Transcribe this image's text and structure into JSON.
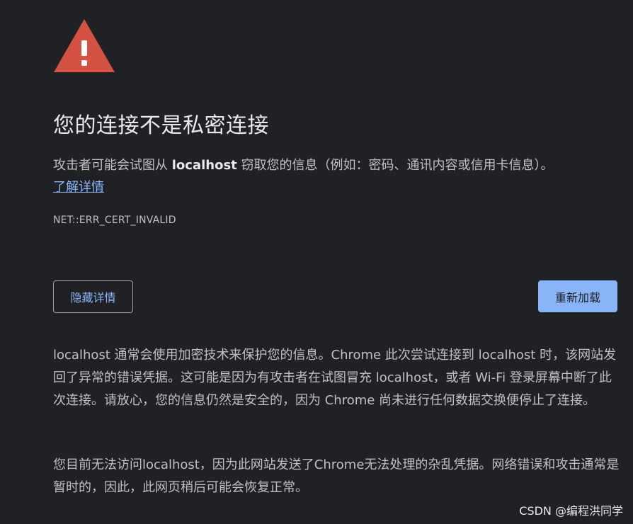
{
  "title": "您的连接不是私密连接",
  "intro": {
    "before_host": "攻击者可能会试图从 ",
    "host": "localhost",
    "after_host": " 窃取您的信息（例如：密码、通讯内容或信用卡信息）。"
  },
  "learn_more_label": "了解详情",
  "error_code": "NET::ERR_CERT_INVALID",
  "buttons": {
    "hide_details": "隐藏详情",
    "reload": "重新加载"
  },
  "details": {
    "paragraph_1": "localhost 通常会使用加密技术来保护您的信息。Chrome 此次尝试连接到 localhost 时，该网站发回了异常的错误凭据。这可能是因为有攻击者在试图冒充 localhost，或者 Wi-Fi 登录屏幕中断了此次连接。请放心，您的信息仍然是安全的，因为 Chrome 尚未进行任何数据交换便停止了连接。",
    "paragraph_2": "您目前无法访问localhost，因为此网站发送了Chrome无法处理的杂乱凭据。网络错误和攻击通常是暂时的，因此，此网页稍后可能会恢复正常。"
  },
  "watermark": "CSDN @编程洪同学",
  "colors": {
    "background": "#202124",
    "warning_red": "#d35244",
    "link_blue": "#8ab4f8",
    "text": "#bdc1c6",
    "heading": "#e8eaed"
  },
  "icons": {
    "warning": "warning-triangle-icon"
  }
}
